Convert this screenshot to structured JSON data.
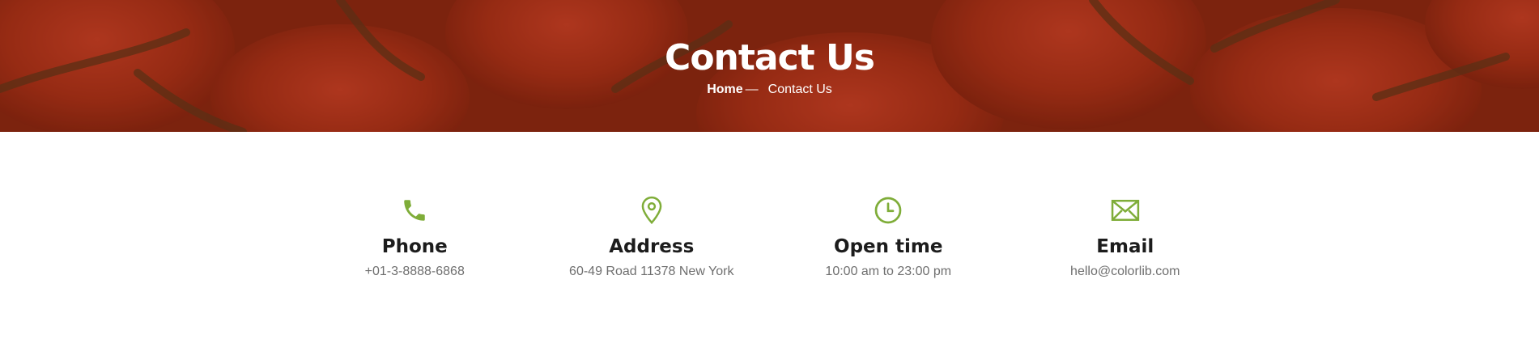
{
  "hero": {
    "title": "Contact Us",
    "breadcrumb": {
      "home": "Home",
      "separator": "—",
      "current": "Contact Us"
    }
  },
  "contact_info": [
    {
      "icon": "phone-icon",
      "title": "Phone",
      "text": "+01-3-8888-6868"
    },
    {
      "icon": "map-pin-icon",
      "title": "Address",
      "text": "60-49 Road 11378 New York"
    },
    {
      "icon": "clock-icon",
      "title": "Open time",
      "text": "10:00 am to 23:00 pm"
    },
    {
      "icon": "envelope-icon",
      "title": "Email",
      "text": "hello@colorlib.com"
    }
  ],
  "colors": {
    "accent": "#7fad39",
    "hero_overlay": "#8a2a12",
    "heading": "#1c1c1c",
    "body_text": "#6f6f6f"
  }
}
